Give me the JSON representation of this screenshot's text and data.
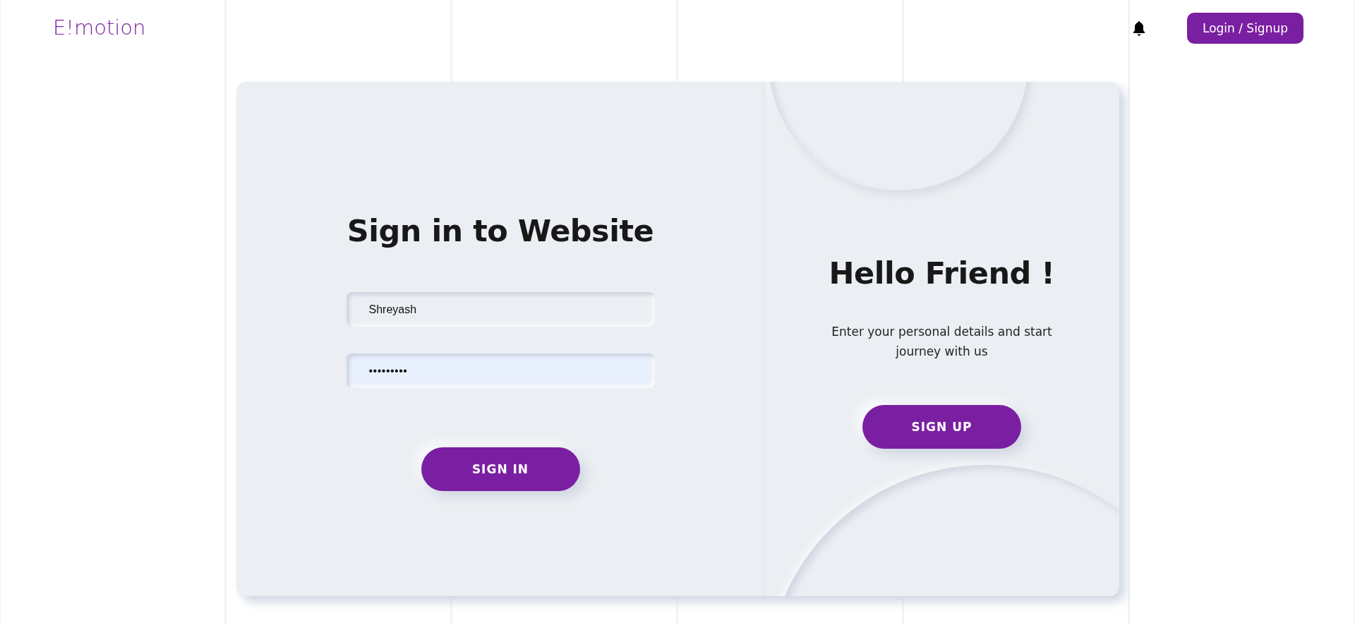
{
  "header": {
    "logo": "E!motion",
    "login_button": "Login / Signup"
  },
  "sign_in": {
    "title": "Sign in to Website",
    "fields": [
      {
        "kind": "text",
        "value": "Shreyash",
        "highlighted": false
      },
      {
        "kind": "password",
        "value": "•••••••••",
        "highlighted": true
      }
    ],
    "button": "SIGN IN"
  },
  "welcome": {
    "title": "Hello Friend !",
    "text": "Enter your personal details and start journey with us",
    "button": "SIGN UP"
  }
}
